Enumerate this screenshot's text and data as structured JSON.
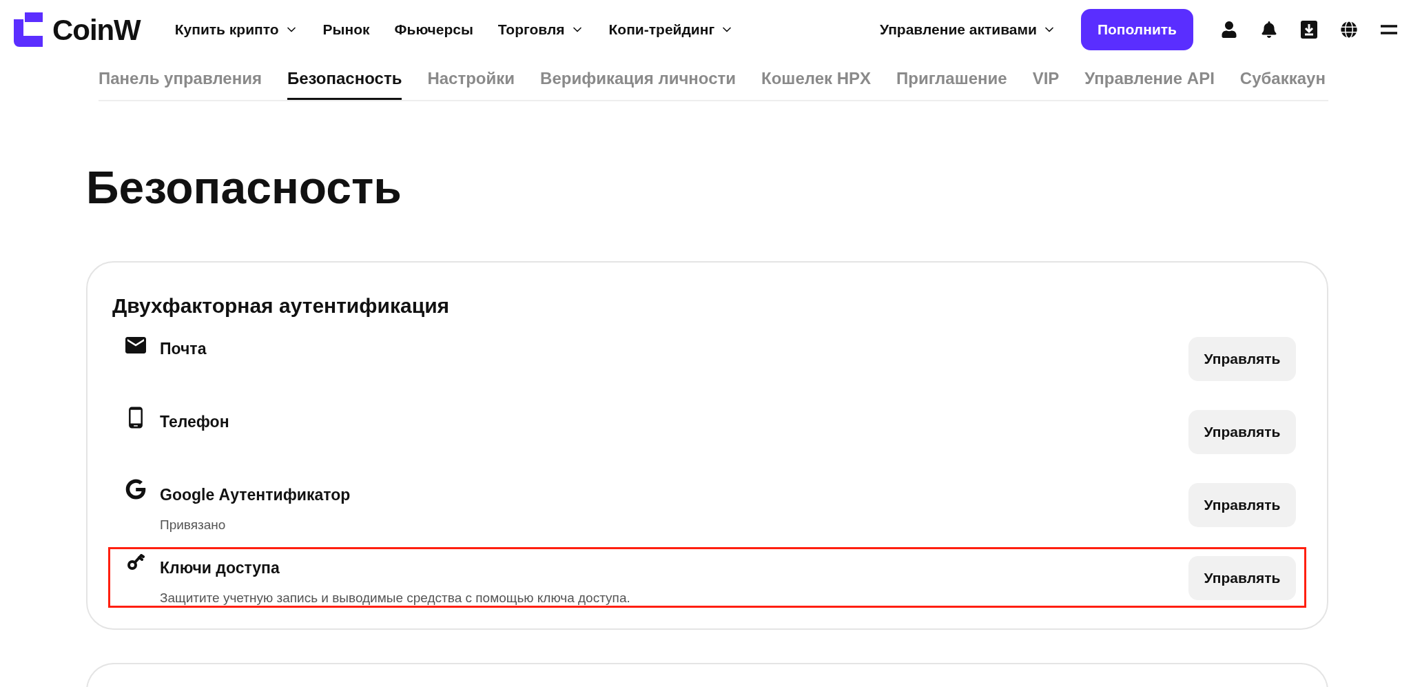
{
  "header": {
    "logo": "CoinW",
    "nav": [
      {
        "label": "Купить крипто",
        "dropdown": true
      },
      {
        "label": "Рынок",
        "dropdown": false
      },
      {
        "label": "Фьючерсы",
        "dropdown": false
      },
      {
        "label": "Торговля",
        "dropdown": true
      },
      {
        "label": "Копи-трейдинг",
        "dropdown": true
      }
    ],
    "assets": {
      "label": "Управление активами",
      "dropdown": true
    },
    "deposit_button": "Пополнить"
  },
  "tabs": [
    {
      "label": "Панель управления",
      "selected": false
    },
    {
      "label": "Безопасность",
      "selected": true
    },
    {
      "label": "Настройки",
      "selected": false
    },
    {
      "label": "Верификация личности",
      "selected": false
    },
    {
      "label": "Кошелек HPX",
      "selected": false
    },
    {
      "label": "Приглашение",
      "selected": false
    },
    {
      "label": "VIP",
      "selected": false
    },
    {
      "label": "Управление API",
      "selected": false
    },
    {
      "label": "Субаккаун",
      "selected": false
    }
  ],
  "page_title": "Безопасность",
  "card": {
    "title": "Двухфакторная аутентификация",
    "rows": [
      {
        "kind": "mail",
        "label": "Почта",
        "button": "Управлять",
        "highlighted": false
      },
      {
        "kind": "phone",
        "label": "Телефон",
        "button": "Управлять",
        "highlighted": false
      },
      {
        "kind": "google",
        "label": "Google Аутентификатор",
        "description": "Привязано",
        "button": "Управлять",
        "highlighted": false
      },
      {
        "kind": "key",
        "label": "Ключи доступа",
        "description": "Защитите учетную запись и выводимые средства с помощью ключа доступа.",
        "button": "Управлять",
        "highlighted": true
      }
    ]
  }
}
